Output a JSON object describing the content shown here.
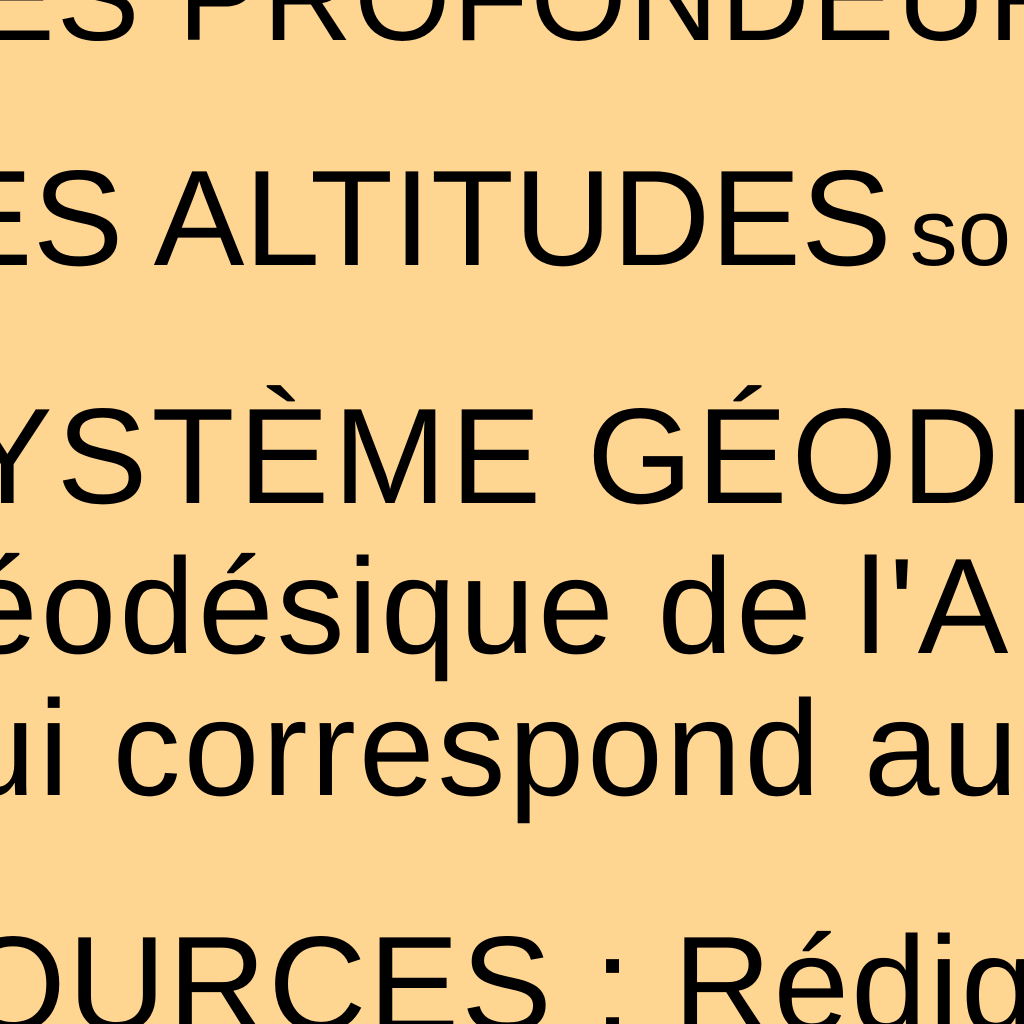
{
  "document": {
    "background_color": "#FFD592",
    "text_color": "#000000",
    "lines": {
      "line1": "ES PROFONDEUR",
      "line2_caps": "ES ALTITUDES",
      "line2_rest": "so",
      "line3": "YSTÈME GÉODÉ",
      "line4": "éodésique de l'A",
      "line5": "ui correspond au V",
      "line6": "OURCES : Rédigé"
    }
  }
}
